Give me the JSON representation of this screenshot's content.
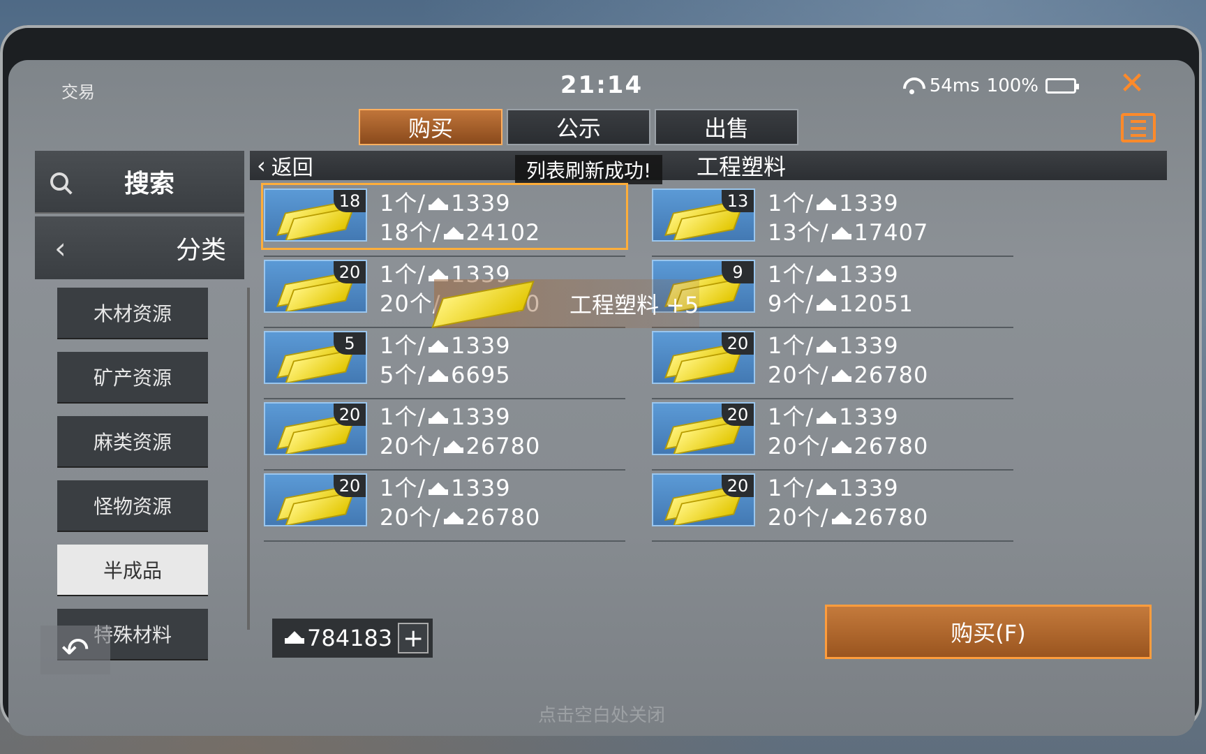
{
  "status": {
    "title": "交易",
    "time": "21:14",
    "ping": "54ms",
    "battery": "100%"
  },
  "tabs": [
    {
      "label": "购买",
      "active": true
    },
    {
      "label": "公示",
      "active": false
    },
    {
      "label": "出售",
      "active": false
    }
  ],
  "sidebar": {
    "search_label": "搜索",
    "category_label": "分类",
    "items": [
      {
        "label": "木材资源",
        "active": false
      },
      {
        "label": "矿产资源",
        "active": false
      },
      {
        "label": "麻类资源",
        "active": false
      },
      {
        "label": "怪物资源",
        "active": false
      },
      {
        "label": "半成品",
        "active": true
      },
      {
        "label": "特殊材料",
        "active": false
      }
    ]
  },
  "header": {
    "back_label": "返回",
    "title": "工程塑料",
    "toast": "列表刷新成功!"
  },
  "listings": [
    {
      "count": "18",
      "unit": "1个/",
      "unit_price": "1339",
      "total_qty": "18个/",
      "total_price": "24102"
    },
    {
      "count": "13",
      "unit": "1个/",
      "unit_price": "1339",
      "total_qty": "13个/",
      "total_price": "17407"
    },
    {
      "count": "20",
      "unit": "1个/",
      "unit_price": "1339",
      "total_qty": "20个/",
      "total_price": "26780"
    },
    {
      "count": "9",
      "unit": "1个/",
      "unit_price": "1339",
      "total_qty": "9个/",
      "total_price": "12051"
    },
    {
      "count": "5",
      "unit": "1个/",
      "unit_price": "1339",
      "total_qty": "5个/",
      "total_price": "6695"
    },
    {
      "count": "20",
      "unit": "1个/",
      "unit_price": "1339",
      "total_qty": "20个/",
      "total_price": "26780"
    },
    {
      "count": "20",
      "unit": "1个/",
      "unit_price": "1339",
      "total_qty": "20个/",
      "total_price": "26780"
    },
    {
      "count": "20",
      "unit": "1个/",
      "unit_price": "1339",
      "total_qty": "20个/",
      "total_price": "26780"
    },
    {
      "count": "20",
      "unit": "1个/",
      "unit_price": "1339",
      "total_qty": "20个/",
      "total_price": "26780"
    },
    {
      "count": "20",
      "unit": "1个/",
      "unit_price": "1339",
      "total_qty": "20个/",
      "total_price": "26780"
    }
  ],
  "pickup_notice": "工程塑料 +5",
  "wallet": {
    "amount": "784183"
  },
  "buy_button": "购买(F)",
  "close_hint": "点击空白处关闭",
  "colors": {
    "accent": "#ff8a2a",
    "selected_border": "#ffae3a"
  }
}
